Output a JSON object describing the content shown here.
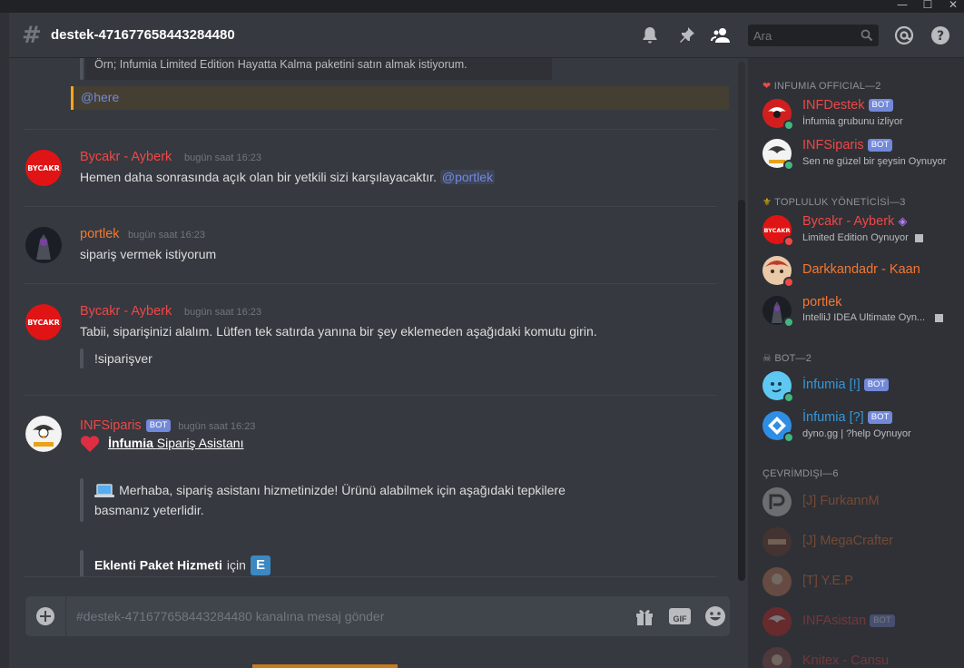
{
  "window": {
    "minimize": "—",
    "maximize": "☐",
    "close": "✕"
  },
  "header": {
    "channel": "destek-471677658443284480",
    "search_placeholder": "Ara"
  },
  "messages": {
    "top_quote": "Örn; Infumia Limited Edition Hayatta Kalma paketini satın almak istiyorum.",
    "here_mention": "@here",
    "m1": {
      "author": "Bycakr - Ayberk",
      "time": "bugün saat 16:23",
      "text": "Hemen daha sonrasında açık olan bir yetkili sizi karşılayacaktır.",
      "mention": "@portlek"
    },
    "m2": {
      "author": "portlek",
      "time": "bugün saat 16:23",
      "text": "sipariş vermek istiyorum"
    },
    "m3": {
      "author": "Bycakr - Ayberk",
      "time": "bugün saat 16:23",
      "text": "Tabii, siparişinizi alalım. Lütfen tek satırda yanına bir şey eklemeden aşağıdaki komutu girin.",
      "quote": "!siparişver"
    },
    "m4": {
      "author": "INFSiparis",
      "bot_tag": "BOT",
      "time": "bugün saat 16:23",
      "heading_bold": "İnfumia",
      "heading_rest": "Sipariş Asistanı",
      "body_line1": "Merhaba, sipariş asistanı hizmetinizde! Ürünü alabilmek için aşağıdaki tepkilere",
      "body_line2": "basmanız yeterlidir.",
      "item_bold": "Eklenti Paket Hizmeti",
      "item_rest": "için",
      "item_emoji": "E"
    }
  },
  "composer": {
    "placeholder": "#destek-471677658443284480 kanalına mesaj gönder",
    "gif": "GIF"
  },
  "members": {
    "groups": [
      {
        "title": "INFUMIA OFFICIAL—2"
      },
      {
        "title": "TOPLULUK YÖNETİCİSİ—3"
      },
      {
        "title": "BOT—2"
      },
      {
        "title": "ÇEVRİMDIŞI—6"
      }
    ],
    "list": [
      {
        "name": "INFDestek",
        "tag": "BOT",
        "sub": "İnfumia grubunu izliyor"
      },
      {
        "name": "INFSiparis",
        "tag": "BOT",
        "sub": "Sen ne güzel bir şeysin Oynuyor"
      },
      {
        "name": "Bycakr - Ayberk",
        "sub": "Limited Edition Oynuyor"
      },
      {
        "name": "Darkkandadr - Kaan"
      },
      {
        "name": "portlek",
        "sub": "IntelliJ IDEA Ultimate Oyn..."
      },
      {
        "name": "İnfumia [!]",
        "tag": "BOT"
      },
      {
        "name": "İnfumia [?]",
        "tag": "BOT",
        "sub": "dyno.gg | ?help Oynuyor"
      },
      {
        "name": "[J] FurkannM"
      },
      {
        "name": "[J] MegaCrafter"
      },
      {
        "name": "[T] Y.E.P"
      },
      {
        "name": "INFAsistan",
        "tag": "BOT"
      },
      {
        "name": "Knitex - Cansu"
      }
    ]
  },
  "colors": {
    "red_role": "#f04747",
    "orange_role": "#f57731",
    "blue_role": "#3498db",
    "brand": "#7289da"
  }
}
